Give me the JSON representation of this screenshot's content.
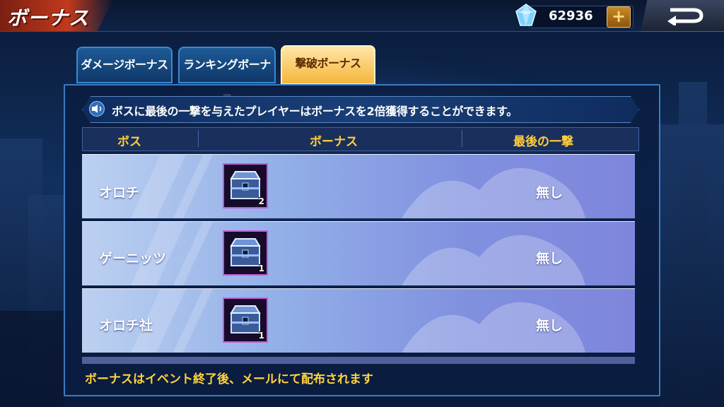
{
  "header": {
    "title": "ボーナス",
    "gem_count": "62936",
    "plus_label": "+",
    "gem_icon": "diamond-icon",
    "back_icon": "back-arrow-icon"
  },
  "tabs": [
    {
      "label": "ダメージボーナス",
      "active": false
    },
    {
      "label": "ランキングボーナス",
      "active": false
    },
    {
      "label": "撃破ボーナス",
      "active": true
    }
  ],
  "notice": {
    "icon": "speaker-icon",
    "text": "ボスに最後の一撃を与えたプレイヤーはボーナスを2倍獲得することができます。"
  },
  "table": {
    "columns": [
      "ボス",
      "ボーナス",
      "最後の一撃"
    ],
    "rows": [
      {
        "boss": "オロチ",
        "reward_icon": "treasure-chest-icon",
        "quantity": "2",
        "last_hit": "無し"
      },
      {
        "boss": "ゲーニッツ",
        "reward_icon": "treasure-chest-icon",
        "quantity": "1",
        "last_hit": "無し"
      },
      {
        "boss": "オロチ社",
        "reward_icon": "treasure-chest-icon",
        "quantity": "1",
        "last_hit": "無し"
      }
    ]
  },
  "footer_note": "ボーナスはイベント終了後、メールにて配布されます",
  "colors": {
    "accent_gold": "#ffcf3d",
    "tab_active": "#f5b63a",
    "tab_inactive": "#1d5a96",
    "chest_border": "#c45ad8"
  }
}
